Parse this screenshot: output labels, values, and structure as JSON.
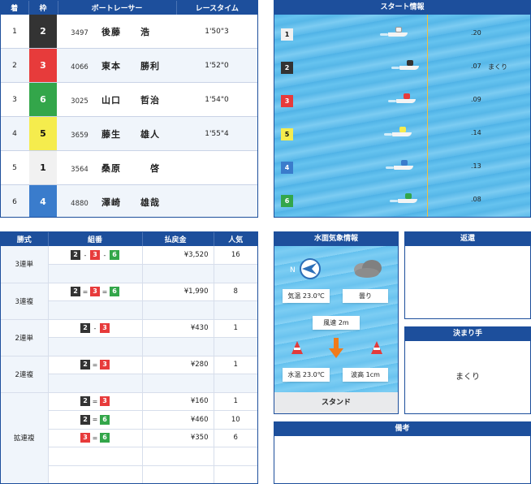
{
  "results": {
    "headers": [
      "着",
      "枠",
      "ボートレーサー",
      "レースタイム"
    ],
    "rows": [
      {
        "rank": "1",
        "waku": "2",
        "id": "3497",
        "name": "後藤　　浩",
        "time": "1'50\"3"
      },
      {
        "rank": "2",
        "waku": "3",
        "id": "4066",
        "name": "東本　　勝利",
        "time": "1'52\"0"
      },
      {
        "rank": "3",
        "waku": "6",
        "id": "3025",
        "name": "山口　　哲治",
        "time": "1'54\"0"
      },
      {
        "rank": "4",
        "waku": "5",
        "id": "3659",
        "name": "藤生　　雄人",
        "time": "1'55\"4"
      },
      {
        "rank": "5",
        "waku": "1",
        "id": "3564",
        "name": "桑原　　　啓",
        "time": ""
      },
      {
        "rank": "6",
        "waku": "4",
        "id": "4880",
        "name": "澤崎　　雄哉",
        "time": ""
      }
    ]
  },
  "start": {
    "title": "スタート情報",
    "rows": [
      {
        "course": "1",
        "st": ".20",
        "kimarite": ""
      },
      {
        "course": "2",
        "st": ".07",
        "kimarite": "まくり"
      },
      {
        "course": "3",
        "st": ".09",
        "kimarite": ""
      },
      {
        "course": "5",
        "st": ".14",
        "kimarite": ""
      },
      {
        "course": "4",
        "st": ".13",
        "kimarite": ""
      },
      {
        "course": "6",
        "st": ".08",
        "kimarite": ""
      }
    ]
  },
  "payout": {
    "headers": [
      "勝式",
      "組番",
      "払戻金",
      "人気"
    ],
    "trifecta": {
      "label": "3連単",
      "combo": [
        "2",
        "3",
        "6"
      ],
      "sep": "-",
      "pay": "¥3,520",
      "pop": "16"
    },
    "trio": {
      "label": "3連複",
      "combo": [
        "2",
        "3",
        "6"
      ],
      "sep": "=",
      "pay": "¥1,990",
      "pop": "8"
    },
    "exacta": {
      "label": "2連単",
      "combo": [
        "2",
        "3"
      ],
      "sep": "-",
      "pay": "¥430",
      "pop": "1"
    },
    "quinella": {
      "label": "2連複",
      "combo": [
        "2",
        "3"
      ],
      "sep": "=",
      "pay": "¥280",
      "pop": "1"
    },
    "wide": {
      "label": "拡連複",
      "rows": [
        {
          "combo": [
            "2",
            "3"
          ],
          "sep": "=",
          "pay": "¥160",
          "pop": "1"
        },
        {
          "combo": [
            "2",
            "6"
          ],
          "sep": "=",
          "pay": "¥460",
          "pop": "10"
        },
        {
          "combo": [
            "3",
            "6"
          ],
          "sep": "=",
          "pay": "¥350",
          "pop": "6"
        }
      ]
    }
  },
  "weather": {
    "title": "水面気象情報",
    "air_temp": "気温 23.0℃",
    "weather": "曇り",
    "wind": "風速 2m",
    "water_temp": "水温 23.0℃",
    "wave": "波高 1cm",
    "compass_label": "N",
    "footer": "スタンド"
  },
  "henkan": {
    "title": "返還"
  },
  "kimarite": {
    "title": "決まり手",
    "value": "まくり"
  },
  "biko": {
    "title": "備考"
  }
}
